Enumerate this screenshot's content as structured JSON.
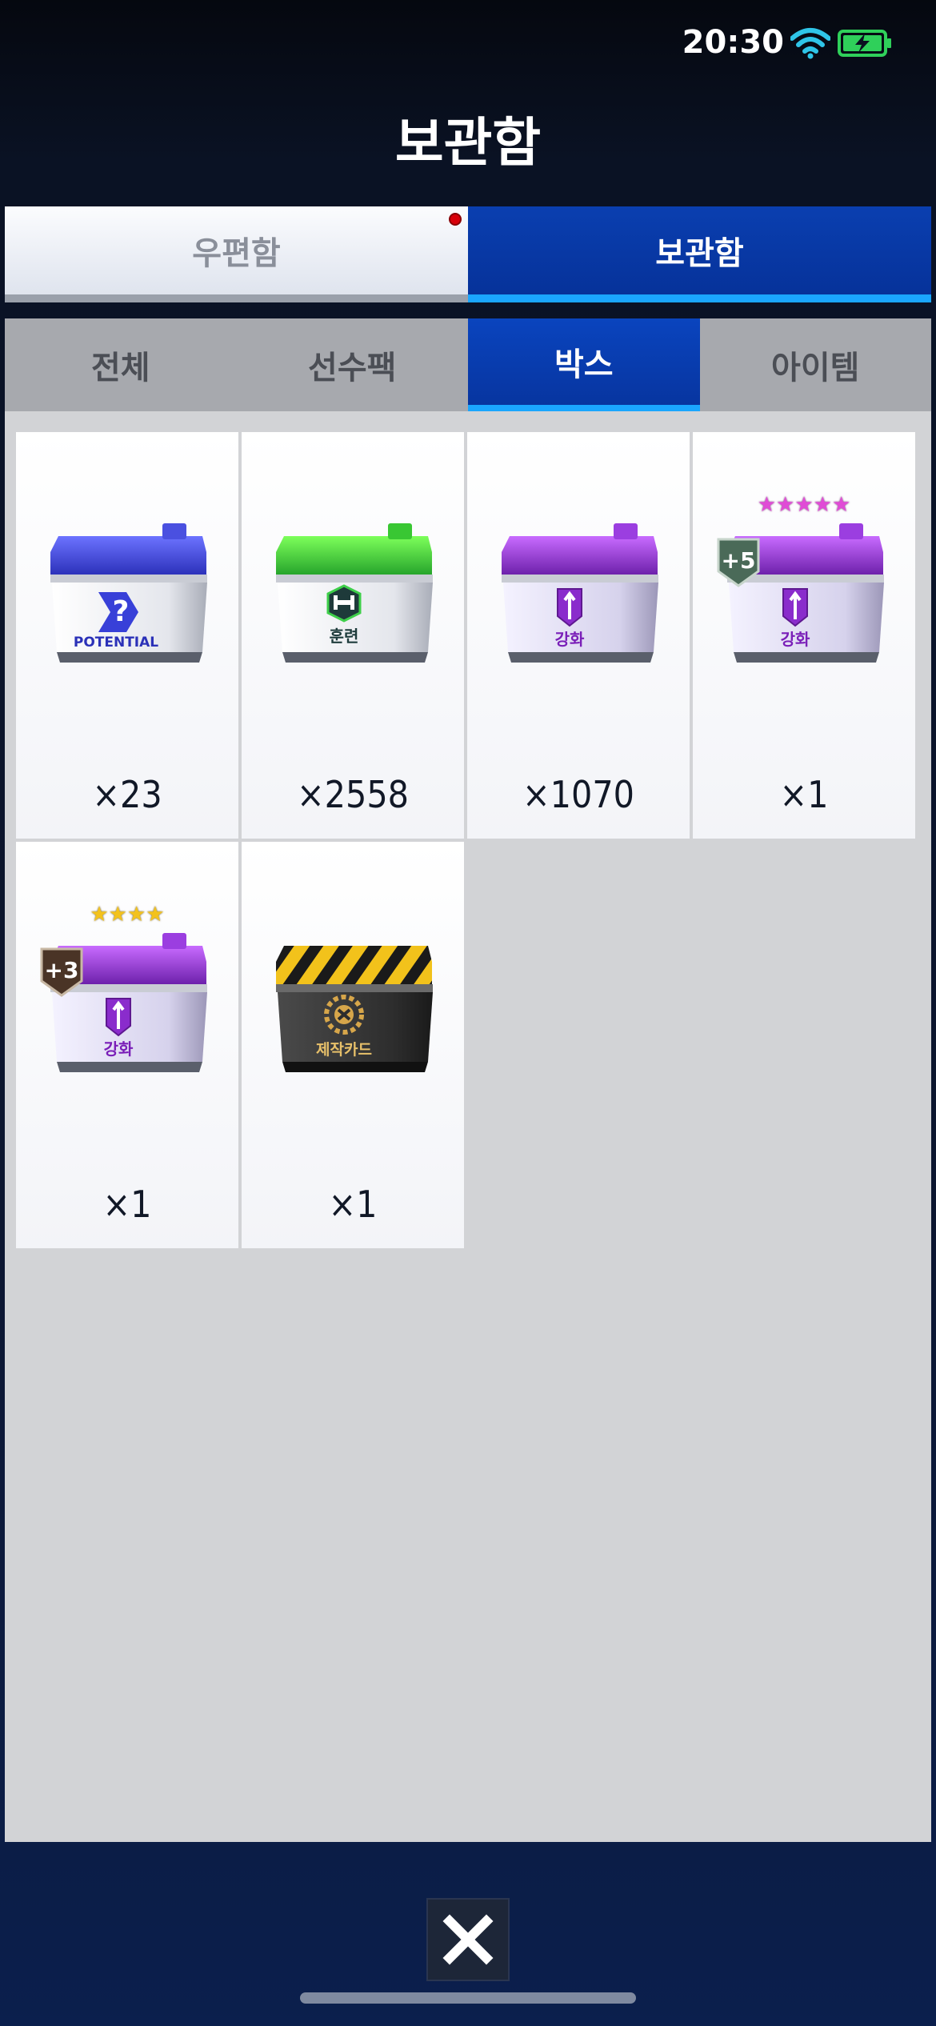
{
  "status": {
    "time": "20:30",
    "wifi_icon": "wifi-icon",
    "battery_icon": "battery-charging-icon"
  },
  "header": {
    "title": "보관함"
  },
  "top_tabs": [
    {
      "label": "우편함",
      "active": false,
      "has_notification": true
    },
    {
      "label": "보관함",
      "active": true
    }
  ],
  "sub_tabs": [
    {
      "label": "전체",
      "active": false
    },
    {
      "label": "선수팩",
      "active": false
    },
    {
      "label": "박스",
      "active": true
    },
    {
      "label": "아이템",
      "active": false
    }
  ],
  "items": [
    {
      "kind": "potential",
      "lid_color": "#3b43d6",
      "label": "POTENTIAL",
      "count": "×23"
    },
    {
      "kind": "training",
      "lid_color": "#38c93a",
      "label": "훈련",
      "count": "×2558"
    },
    {
      "kind": "enhance",
      "lid_color": "#8a2ccc",
      "label": "강화",
      "count": "×1070"
    },
    {
      "kind": "enhance-plus5",
      "lid_color": "#8a2ccc",
      "label": "강화",
      "badge": "+5",
      "stars": "★★★★★",
      "count": "×1"
    },
    {
      "kind": "enhance-plus3",
      "lid_color": "#8a2ccc",
      "label": "강화",
      "badge": "+3",
      "stars": "★★★★",
      "count": "×1"
    },
    {
      "kind": "crafting",
      "lid_color": "#f0c419",
      "label": "제작카드",
      "count": "×1"
    }
  ],
  "footer": {
    "close_icon": "close-icon"
  }
}
